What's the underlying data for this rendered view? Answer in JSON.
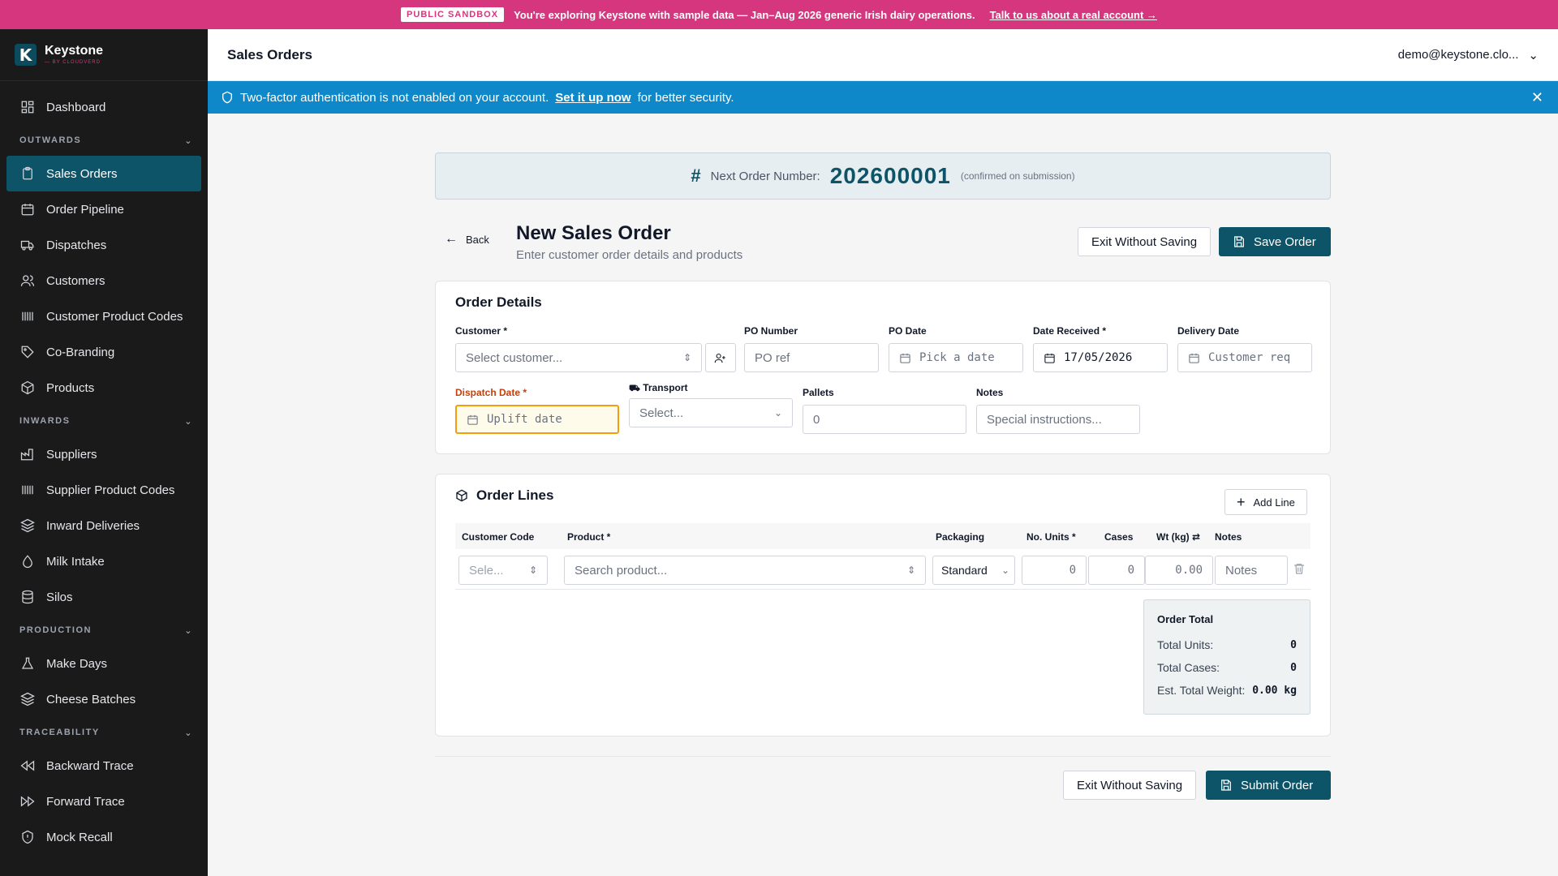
{
  "banner": {
    "tag": "PUBLIC SANDBOX",
    "message": "You're exploring Keystone with sample data — Jan–Aug 2026 generic Irish dairy operations.",
    "link": "Talk to us about a real account →"
  },
  "brand": {
    "name": "Keystone",
    "sub": "— BY CLOUDVERD",
    "mark": "K"
  },
  "sidebar": {
    "top": [
      {
        "label": "Dashboard",
        "icon": "dashboard-icon"
      }
    ],
    "sections": [
      {
        "title": "OUTWARDS",
        "items": [
          {
            "label": "Sales Orders",
            "active": true
          },
          {
            "label": "Order Pipeline"
          },
          {
            "label": "Dispatches"
          },
          {
            "label": "Customers"
          },
          {
            "label": "Customer Product Codes"
          },
          {
            "label": "Co-Branding"
          },
          {
            "label": "Products"
          }
        ]
      },
      {
        "title": "INWARDS",
        "items": [
          {
            "label": "Suppliers"
          },
          {
            "label": "Supplier Product Codes"
          },
          {
            "label": "Inward Deliveries"
          },
          {
            "label": "Milk Intake"
          },
          {
            "label": "Silos"
          }
        ]
      },
      {
        "title": "PRODUCTION",
        "items": [
          {
            "label": "Make Days"
          },
          {
            "label": "Cheese Batches"
          }
        ]
      },
      {
        "title": "TRACEABILITY",
        "items": [
          {
            "label": "Backward Trace"
          },
          {
            "label": "Forward Trace"
          },
          {
            "label": "Mock Recall"
          }
        ]
      }
    ]
  },
  "header": {
    "title": "Sales Orders",
    "user": "demo@keystone.clo..."
  },
  "alert": {
    "pre": "Two-factor authentication is not enabled on your account.",
    "link": "Set it up now",
    "post": "for better security."
  },
  "order_number": {
    "label": "Next Order Number:",
    "value": "202600001",
    "note": "(confirmed on submission)"
  },
  "page": {
    "back": "Back",
    "title": "New Sales Order",
    "subtitle": "Enter customer order details and products",
    "exit": "Exit Without Saving",
    "save": "Save Order"
  },
  "details": {
    "title": "Order Details",
    "customer_label": "Customer *",
    "customer_placeholder": "Select customer...",
    "po_number_label": "PO Number",
    "po_number_placeholder": "PO ref",
    "po_date_label": "PO Date",
    "po_date_placeholder": "Pick a date",
    "date_received_label": "Date Received *",
    "date_received_value": "17/05/2026",
    "delivery_date_label": "Delivery Date",
    "delivery_date_placeholder": "Customer req",
    "dispatch_label": "Dispatch Date *",
    "dispatch_placeholder": "Uplift date",
    "transport_label": "Transport",
    "transport_placeholder": "Select...",
    "pallets_label": "Pallets",
    "pallets_placeholder": "0",
    "notes_label": "Notes",
    "notes_placeholder": "Special instructions..."
  },
  "lines": {
    "title": "Order Lines",
    "add": "Add Line",
    "headers": [
      "Customer Code",
      "Product *",
      "Packaging",
      "No. Units *",
      "Cases",
      "Wt (kg) ⇄",
      "Notes"
    ],
    "row": {
      "code": "Sele...",
      "product": "Search product...",
      "packaging": "Standard",
      "units": "0",
      "cases": "0",
      "weight": "0.00",
      "notes": "Notes"
    }
  },
  "totals": {
    "title": "Order Total",
    "units_label": "Total Units:",
    "units": "0",
    "cases_label": "Total Cases:",
    "cases": "0",
    "weight_label": "Est. Total Weight:",
    "weight": "0.00 kg"
  },
  "footer": {
    "exit": "Exit Without Saving",
    "submit": "Submit Order"
  }
}
